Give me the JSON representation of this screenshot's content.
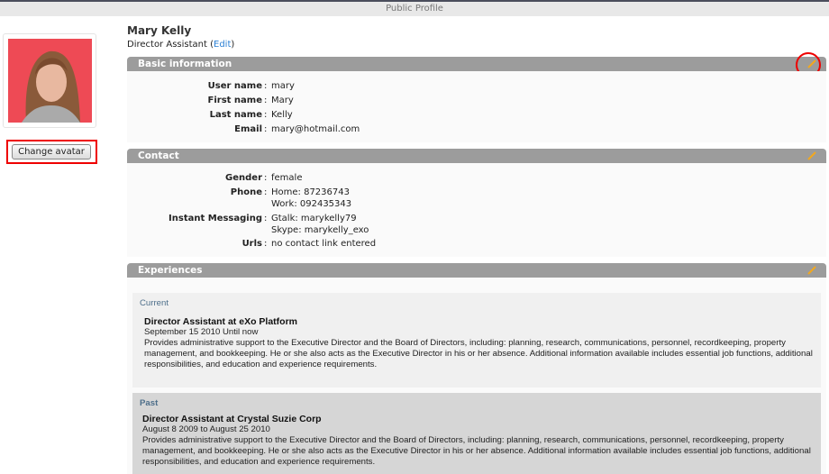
{
  "window": {
    "title": "Public Profile"
  },
  "profile": {
    "name": "Mary Kelly",
    "position": "Director Assistant",
    "edit_open": "(",
    "edit_label": "Edit",
    "edit_close": ")",
    "change_avatar": "Change avatar"
  },
  "basic": {
    "title": "Basic information",
    "rows": [
      {
        "label": "User name",
        "value": "mary"
      },
      {
        "label": "First name",
        "value": "Mary"
      },
      {
        "label": "Last name",
        "value": "Kelly"
      },
      {
        "label": "Email",
        "value": "mary@hotmail.com"
      }
    ]
  },
  "contact": {
    "title": "Contact",
    "gender": {
      "label": "Gender",
      "value": "female"
    },
    "phone": {
      "label": "Phone",
      "values": [
        "Home: 87236743",
        "Work: 092435343"
      ]
    },
    "im": {
      "label": "Instant Messaging",
      "values": [
        "Gtalk: marykelly79",
        "Skype: marykelly_exo"
      ]
    },
    "urls": {
      "label": "Urls",
      "value": "no contact link entered"
    }
  },
  "experiences": {
    "title": "Experiences",
    "items": [
      {
        "tag": "Current",
        "title": "Director Assistant at eXo Platform",
        "dates": "September 15 2010 Until now",
        "description": "Provides administrative support to the Executive Director and the Board of Directors, including: planning, research, communications, personnel, recordkeeping, property management, and bookkeeping. He or she also acts as the Executive Director in his or her absence. Additional information available includes essential job functions, additional responsibilities, and education and experience requirements."
      },
      {
        "tag": "Past",
        "title": "Director Assistant at Crystal Suzie Corp",
        "dates": "August 8 2009 to August 25 2010",
        "description": "Provides administrative support to the Executive Director and the Board of Directors, including: planning, research, communications, personnel, recordkeeping, property management, and bookkeeping. He or she also acts as the Executive Director in his or her absence. Additional information available includes essential job functions, additional responsibilities, and education and experience requirements."
      }
    ]
  },
  "colors": {
    "header": "#9c9c9c",
    "highlight": "#e00000",
    "link": "#2a7fd4"
  }
}
